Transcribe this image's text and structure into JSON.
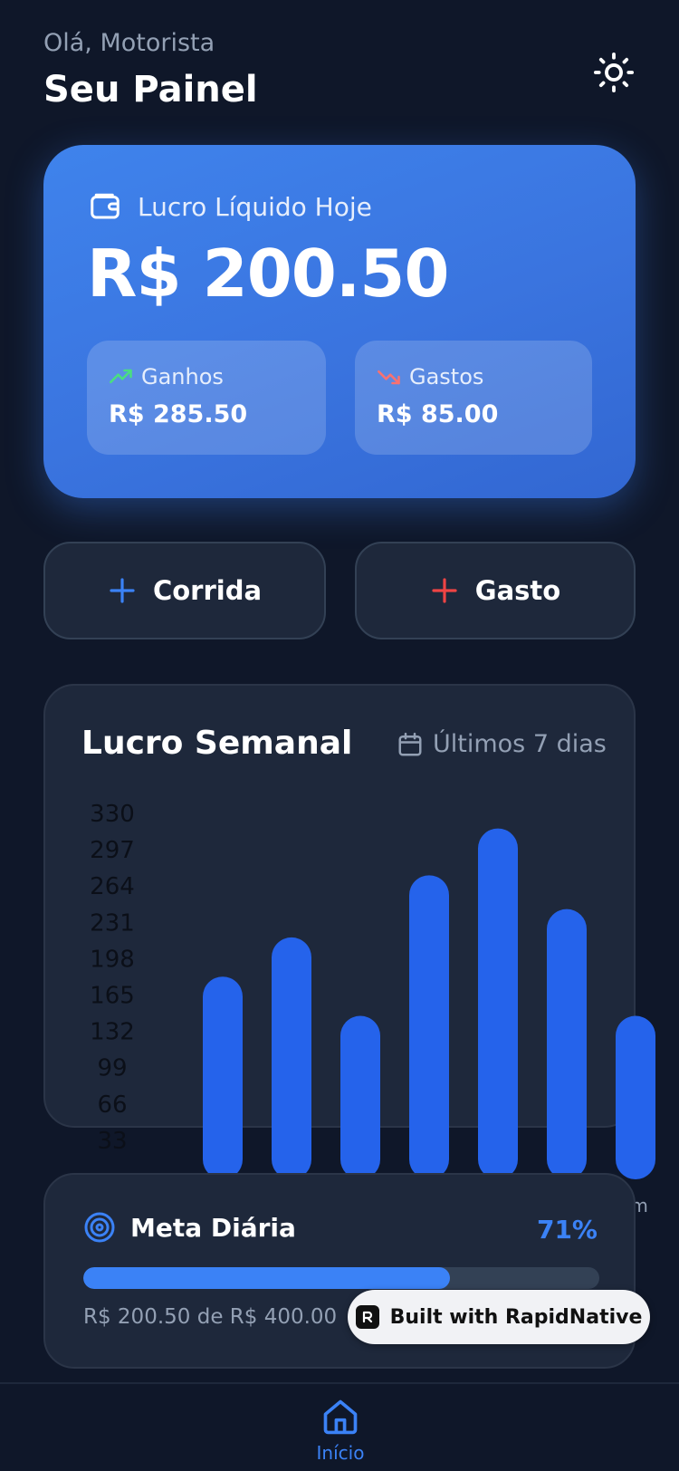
{
  "header": {
    "greeting": "Olá, Motorista",
    "title": "Seu Painel",
    "theme_icon": "sun-icon"
  },
  "hero": {
    "label": "Lucro Líquido Hoje",
    "value": "R$ 200.50",
    "earnings": {
      "label": "Ganhos",
      "value": "R$ 285.50"
    },
    "expenses": {
      "label": "Gastos",
      "value": "R$ 85.00"
    }
  },
  "actions": {
    "ride_label": "Corrida",
    "expense_label": "Gasto"
  },
  "weekly": {
    "title": "Lucro Semanal",
    "range": "Últimos 7 dias"
  },
  "chart_data": {
    "type": "bar",
    "y_ticks": [
      "330",
      "297",
      "264",
      "231",
      "198",
      "165",
      "132",
      "99",
      "66",
      "33"
    ],
    "ylim": [
      0,
      330
    ],
    "values": [
      186,
      222,
      150,
      279,
      322,
      248,
      150
    ],
    "visible_x_label": "om",
    "color": "#2563eb"
  },
  "goal": {
    "title": "Meta Diária",
    "percent": "71%",
    "progress": 0.71,
    "text": "R$ 200.50 de R$ 400.00"
  },
  "badge": {
    "label": "Built with RapidNative"
  },
  "nav": {
    "home_label": "Início"
  },
  "colors": {
    "background": "#0f1729",
    "card": "#1e283b",
    "accent": "#3b82f6",
    "positive": "#4ade80",
    "negative": "#f87171"
  }
}
